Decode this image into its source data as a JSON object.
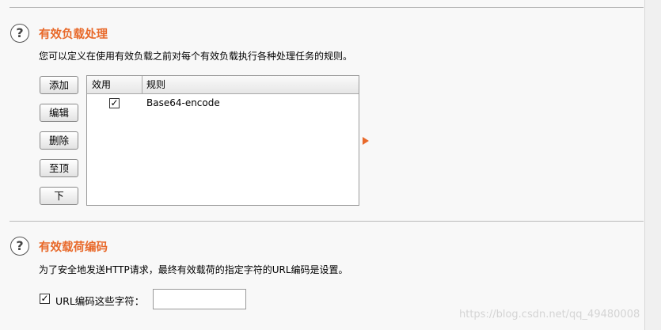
{
  "payload_processing": {
    "title": "有效负载处理",
    "description": "您可以定义在使用有效负载之前对每个有效负载执行各种处理任务的规则。",
    "buttons": {
      "add": "添加",
      "edit": "编辑",
      "delete": "删除",
      "top": "至顶",
      "down": "下"
    },
    "table": {
      "columns": {
        "enabled": "效用",
        "rule": "规则"
      },
      "rows": [
        {
          "enabled": true,
          "rule": "Base64-encode"
        }
      ]
    }
  },
  "payload_encoding": {
    "title": "有效载荷编码",
    "description": "为了安全地发送HTTP请求，最终有效载荷的指定字符的URL编码是设置。",
    "url_encode_checked": true,
    "url_encode_label": "URL编码这些字符：",
    "url_encode_chars": ""
  },
  "icons": {
    "help": "help-circle-icon",
    "check": "checkmark-icon",
    "expand": "triangle-right-icon"
  },
  "colors": {
    "accent": "#e8692a"
  },
  "watermark": "https://blog.csdn.net/qq_49480008"
}
